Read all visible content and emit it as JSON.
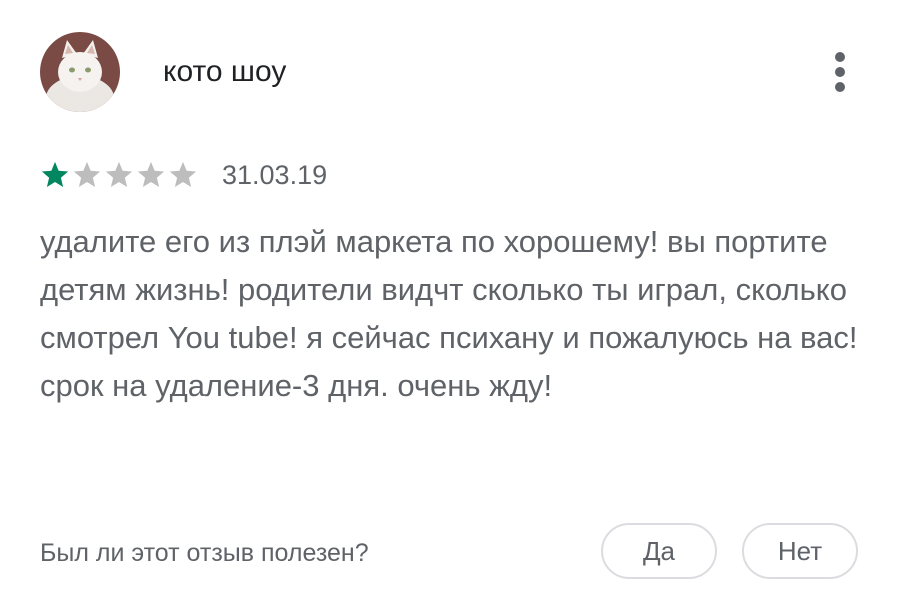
{
  "review": {
    "author": "кото шоу",
    "rating": 1,
    "rating_max": 5,
    "date": "31.03.19",
    "text": "удалите его из плэй маркета по хорошему! вы портите детям жизнь! родители видчт сколько ты играл, сколько смотрел You tube! я сейчас психану и пожалуюсь на вас! срок на удаление-3 дня. очень жду!"
  },
  "icons": {
    "avatar": "white-cat-avatar",
    "menu": "more-vert-icon",
    "star": "star-icon"
  },
  "colors": {
    "star_filled": "#01875f",
    "star_empty": "#bdbdbd",
    "secondary_text": "#5f6368",
    "primary_text": "#202124",
    "button_border": "#dadce0"
  },
  "feedback": {
    "question": "Был ли этот отзыв полезен?",
    "yes_label": "Да",
    "no_label": "Нет"
  }
}
